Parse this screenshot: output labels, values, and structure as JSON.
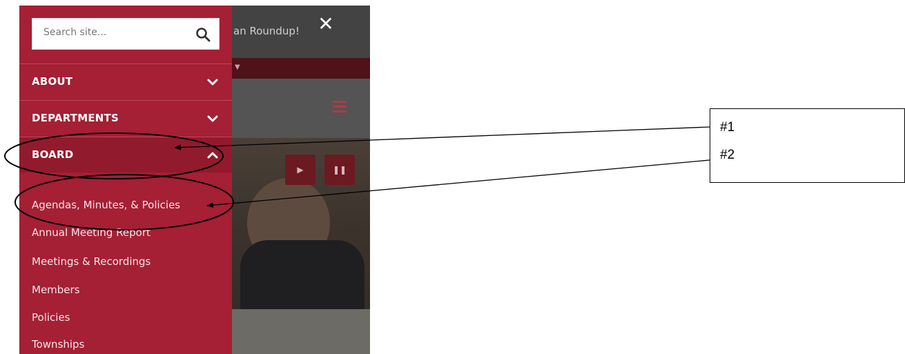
{
  "background": {
    "banner_text": "an Roundup!",
    "close_symbol": "✕",
    "strip_caret": "▼",
    "media_play": "▶",
    "media_pause": "❚❚"
  },
  "search": {
    "placeholder": "Search site...",
    "value": ""
  },
  "menu": {
    "items": [
      {
        "label": "ABOUT",
        "expanded": false,
        "icon": "chevron-down-icon"
      },
      {
        "label": "DEPARTMENTS",
        "expanded": false,
        "icon": "chevron-down-icon"
      },
      {
        "label": "BOARD",
        "expanded": true,
        "icon": "chevron-up-icon"
      }
    ],
    "board_subitems": [
      "Agendas, Minutes, & Policies",
      "Annual Meeting Report",
      "Meetings & Recordings",
      "Members",
      "Policies",
      "Townships"
    ]
  },
  "annotations": {
    "labels": [
      "#1",
      "#2"
    ]
  },
  "colors": {
    "menu_bg": "#a51f35",
    "menu_active_bg": "#921a2d",
    "strip": "#4f1219"
  }
}
